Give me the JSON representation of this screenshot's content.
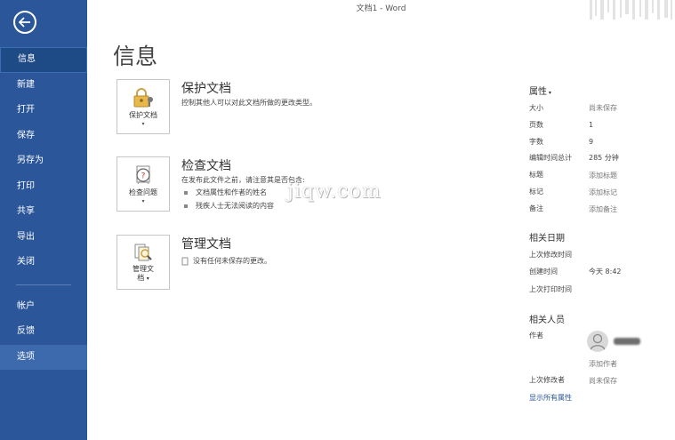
{
  "window": {
    "title": "文档1  -  Word"
  },
  "sidebar": {
    "back_icon": "back-arrow-icon",
    "items": [
      {
        "label": "信息"
      },
      {
        "label": "新建"
      },
      {
        "label": "打开"
      },
      {
        "label": "保存"
      },
      {
        "label": "另存为"
      },
      {
        "label": "打印"
      },
      {
        "label": "共享"
      },
      {
        "label": "导出"
      },
      {
        "label": "关闭"
      },
      {
        "label": "帐户"
      },
      {
        "label": "反馈"
      },
      {
        "label": "选项"
      }
    ],
    "active": "信息",
    "colors": {
      "bg": "#2b579a",
      "active": "#1e4a86"
    }
  },
  "main": {
    "title": "信息",
    "protect": {
      "button": "保护文档",
      "title": "保护文档",
      "desc": "控制其他人可以对此文档所做的更改类型。"
    },
    "inspect": {
      "button": "检查问题",
      "title": "检查文档",
      "desc": "在发布此文件之前，请注意其是否包含:",
      "bullets": [
        "文档属性和作者的姓名",
        "残疾人士无法阅读的内容"
      ]
    },
    "manage": {
      "button_line1": "管理文",
      "button_line2": "档",
      "title": "管理文档",
      "desc": "没有任何未保存的更改。"
    },
    "watermark": "jiqw.com"
  },
  "properties": {
    "heading": "属性",
    "rows": [
      {
        "key": "大小",
        "value": "尚未保存"
      },
      {
        "key": "页数",
        "value": "1"
      },
      {
        "key": "字数",
        "value": "9"
      },
      {
        "key": "编辑时间总计",
        "value": "285 分钟"
      },
      {
        "key": "标题",
        "value": "添加标题"
      },
      {
        "key": "标记",
        "value": "添加标记"
      },
      {
        "key": "备注",
        "value": "添加备注"
      }
    ],
    "dates_heading": "相关日期",
    "dates": [
      {
        "key": "上次修改时间",
        "value": ""
      },
      {
        "key": "创建时间",
        "value": "今天 8:42"
      },
      {
        "key": "上次打印时间",
        "value": ""
      }
    ],
    "people_heading": "相关人员",
    "author_label": "作者",
    "add_author": "添加作者",
    "last_modified_by_label": "上次修改者",
    "last_modified_by_value": "尚未保存",
    "show_all": "显示所有属性"
  }
}
